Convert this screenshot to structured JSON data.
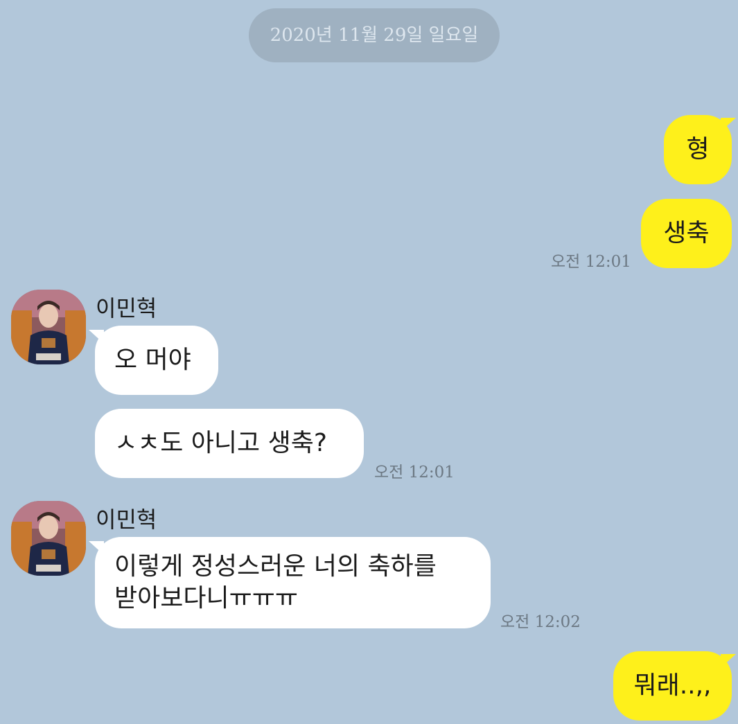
{
  "date_divider": "2020년 11월 29일 일요일",
  "messages": {
    "m1": "형",
    "m2": "생축",
    "m2_time": "오전 12:01",
    "m3_sender": "이민혁",
    "m3": "오 머야",
    "m4": "ㅅㅊ도 아니고 생축?",
    "m4_time": "오전 12:01",
    "m5_sender": "이민혁",
    "m5_line1": "이렇게 정성스러운 너의 축하를",
    "m5_line2": "받아보다니ㅠㅠㅠ",
    "m5_time": "오전 12:02",
    "m6": "뭐래..,,"
  },
  "colors": {
    "background": "#b2c7da",
    "my_bubble": "#fef01b",
    "other_bubble": "#ffffff",
    "date_pill": "#9fb1c1"
  },
  "icons": {
    "avatar": "profile-photo"
  }
}
